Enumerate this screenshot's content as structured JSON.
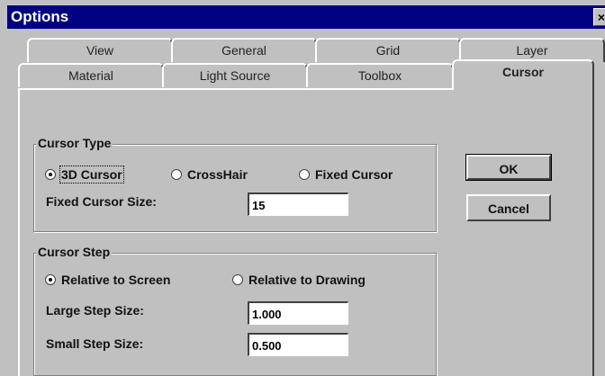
{
  "window": {
    "title": "Options",
    "close_glyph": "×"
  },
  "tabs_back": [
    {
      "label": "View"
    },
    {
      "label": "General"
    },
    {
      "label": "Grid"
    },
    {
      "label": "Layer"
    }
  ],
  "tabs_front": [
    {
      "label": "Material"
    },
    {
      "label": "Light Source"
    },
    {
      "label": "Toolbox"
    },
    {
      "label": "Cursor",
      "active": true
    }
  ],
  "cursor_type": {
    "title": "Cursor Type",
    "options": [
      "3D Cursor",
      "CrossHair",
      "Fixed Cursor"
    ],
    "selected": "3D Cursor",
    "fixed_size_label": "Fixed Cursor Size:",
    "fixed_size_value": "15"
  },
  "cursor_step": {
    "title": "Cursor Step",
    "options": [
      "Relative to Screen",
      "Relative to Drawing"
    ],
    "selected": "Relative to Screen",
    "large_label": "Large Step Size:",
    "large_value": "1.000",
    "small_label": "Small Step Size:",
    "small_value": "0.500"
  },
  "buttons": {
    "ok": "OK",
    "cancel": "Cancel"
  }
}
